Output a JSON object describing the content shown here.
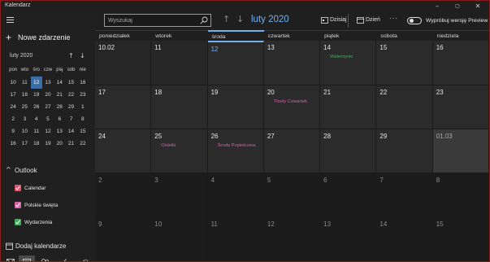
{
  "app": {
    "title": "Kalendarz"
  },
  "window_controls": {
    "minimize": "–",
    "maximize": "▢",
    "close": "✕"
  },
  "sidebar": {
    "new_event_label": "Nowe zdarzenie",
    "mini_calendar": {
      "month_label": "luty 2020",
      "weekdays": [
        "pon",
        "wto",
        "śro",
        "czw",
        "pią",
        "sob",
        "nie"
      ],
      "weeks": [
        [
          "10",
          "11",
          "12",
          "13",
          "14",
          "15",
          "16"
        ],
        [
          "17",
          "18",
          "19",
          "20",
          "21",
          "22",
          "23"
        ],
        [
          "24",
          "25",
          "26",
          "27",
          "28",
          "29",
          "1"
        ],
        [
          "2",
          "3",
          "4",
          "5",
          "6",
          "7",
          "8"
        ],
        [
          "9",
          "10",
          "11",
          "12",
          "13",
          "14",
          "15"
        ],
        [
          "16",
          "17",
          "18",
          "19",
          "20",
          "21",
          "22"
        ]
      ],
      "today": "12"
    },
    "outlook_label": "Outlook",
    "calendars": [
      {
        "label": "Calendar",
        "color": "#e0546e"
      },
      {
        "label": "Polskie święta",
        "color": "#d85fa8"
      },
      {
        "label": "Wydarzenia",
        "color": "#3fae5a"
      }
    ],
    "add_calendars_label": "Dodaj kalendarze"
  },
  "toolbar": {
    "search_placeholder": "Wyszukaj",
    "month_title": "luty 2020",
    "today_label": "Dzisiaj",
    "view_label": "Dzień",
    "more_label": "···",
    "preview_label": "Wypróbuj wersję Preview"
  },
  "calendar": {
    "weekdays": [
      "poniedziałek",
      "wtorek",
      "środa",
      "czwartek",
      "piątek",
      "sobota",
      "niedziela"
    ],
    "weeks": [
      [
        {
          "day": "10.02",
          "state": "past"
        },
        {
          "day": "11",
          "state": "past"
        },
        {
          "day": "12",
          "state": "today"
        },
        {
          "day": "13",
          "state": "current"
        },
        {
          "day": "14",
          "state": "current",
          "event": "Walentynki",
          "event_color": "#3fae5a"
        },
        {
          "day": "15",
          "state": "current"
        },
        {
          "day": "16",
          "state": "current"
        }
      ],
      [
        {
          "day": "17",
          "state": "current"
        },
        {
          "day": "18",
          "state": "current"
        },
        {
          "day": "19",
          "state": "current"
        },
        {
          "day": "20",
          "state": "current",
          "event": "Tłusty Czwartek",
          "event_color": "#d85fa8"
        },
        {
          "day": "21",
          "state": "current"
        },
        {
          "day": "22",
          "state": "current"
        },
        {
          "day": "23",
          "state": "current"
        }
      ],
      [
        {
          "day": "24",
          "state": "current"
        },
        {
          "day": "25",
          "state": "current",
          "event": "Ostatki",
          "event_color": "#d85fa8"
        },
        {
          "day": "26",
          "state": "current",
          "event": "Środa Popielcowa",
          "event_color": "#d85fa8"
        },
        {
          "day": "27",
          "state": "current"
        },
        {
          "day": "28",
          "state": "current"
        },
        {
          "day": "29",
          "state": "current"
        },
        {
          "day": "01.03",
          "state": "selected"
        }
      ],
      [
        {
          "day": "2",
          "state": "other"
        },
        {
          "day": "3",
          "state": "other"
        },
        {
          "day": "4",
          "state": "other"
        },
        {
          "day": "5",
          "state": "other"
        },
        {
          "day": "6",
          "state": "other"
        },
        {
          "day": "7",
          "state": "other"
        },
        {
          "day": "8",
          "state": "other"
        }
      ],
      [
        {
          "day": "9",
          "state": "other"
        },
        {
          "day": "10",
          "state": "other"
        },
        {
          "day": "11",
          "state": "other"
        },
        {
          "day": "12",
          "state": "other"
        },
        {
          "day": "13",
          "state": "other"
        },
        {
          "day": "14",
          "state": "other"
        },
        {
          "day": "15",
          "state": "other"
        }
      ]
    ]
  },
  "bottom_nav": [
    "mail-icon",
    "calendar-icon",
    "people-icon",
    "todo-icon",
    "settings-icon"
  ]
}
